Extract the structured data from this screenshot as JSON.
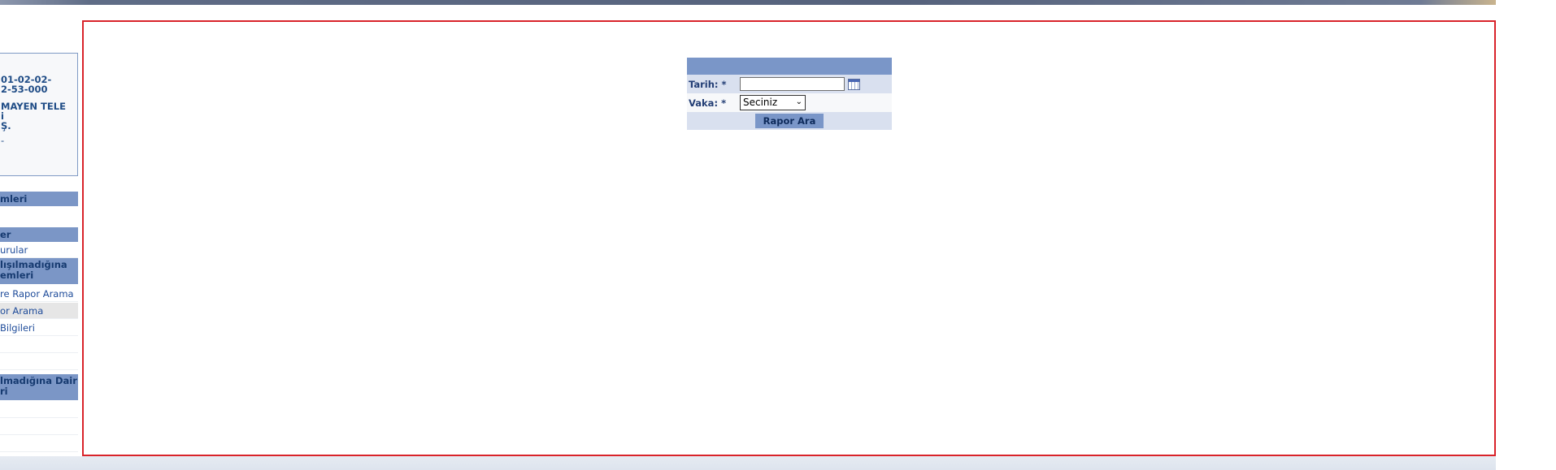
{
  "sidebar": {
    "info_lines": [
      "01-02-02-",
      "2-53-000",
      "MAYEN TELE",
      "i",
      "Ş.",
      "-"
    ],
    "header1": "mleri",
    "header2": "er",
    "items": [
      {
        "label": "urular"
      }
    ],
    "header3_line1": "lışılmadığına",
    "header3_line2": "emleri",
    "items2": [
      {
        "label": "re Rapor Arama"
      },
      {
        "label": "or Arama"
      },
      {
        "label": " Bilgileri"
      },
      {
        "label": ""
      },
      {
        "label": ""
      }
    ],
    "header4_line1": "lmadığına Dair",
    "header4_line2": "ri"
  },
  "form": {
    "date_label": "Tarih:",
    "date_required": "*",
    "date_value": "",
    "case_label": "Vaka:",
    "case_required": "*",
    "case_selected": "Seciniz",
    "case_arrow": "⌄",
    "search_button": "Rapor Ara"
  },
  "icons": {
    "calendar": "calendar-icon"
  },
  "colors": {
    "header_blue": "#7a96c8",
    "row_light": "#d9e0ef",
    "border_red": "#d9232a",
    "link_blue": "#1f4c9a"
  }
}
